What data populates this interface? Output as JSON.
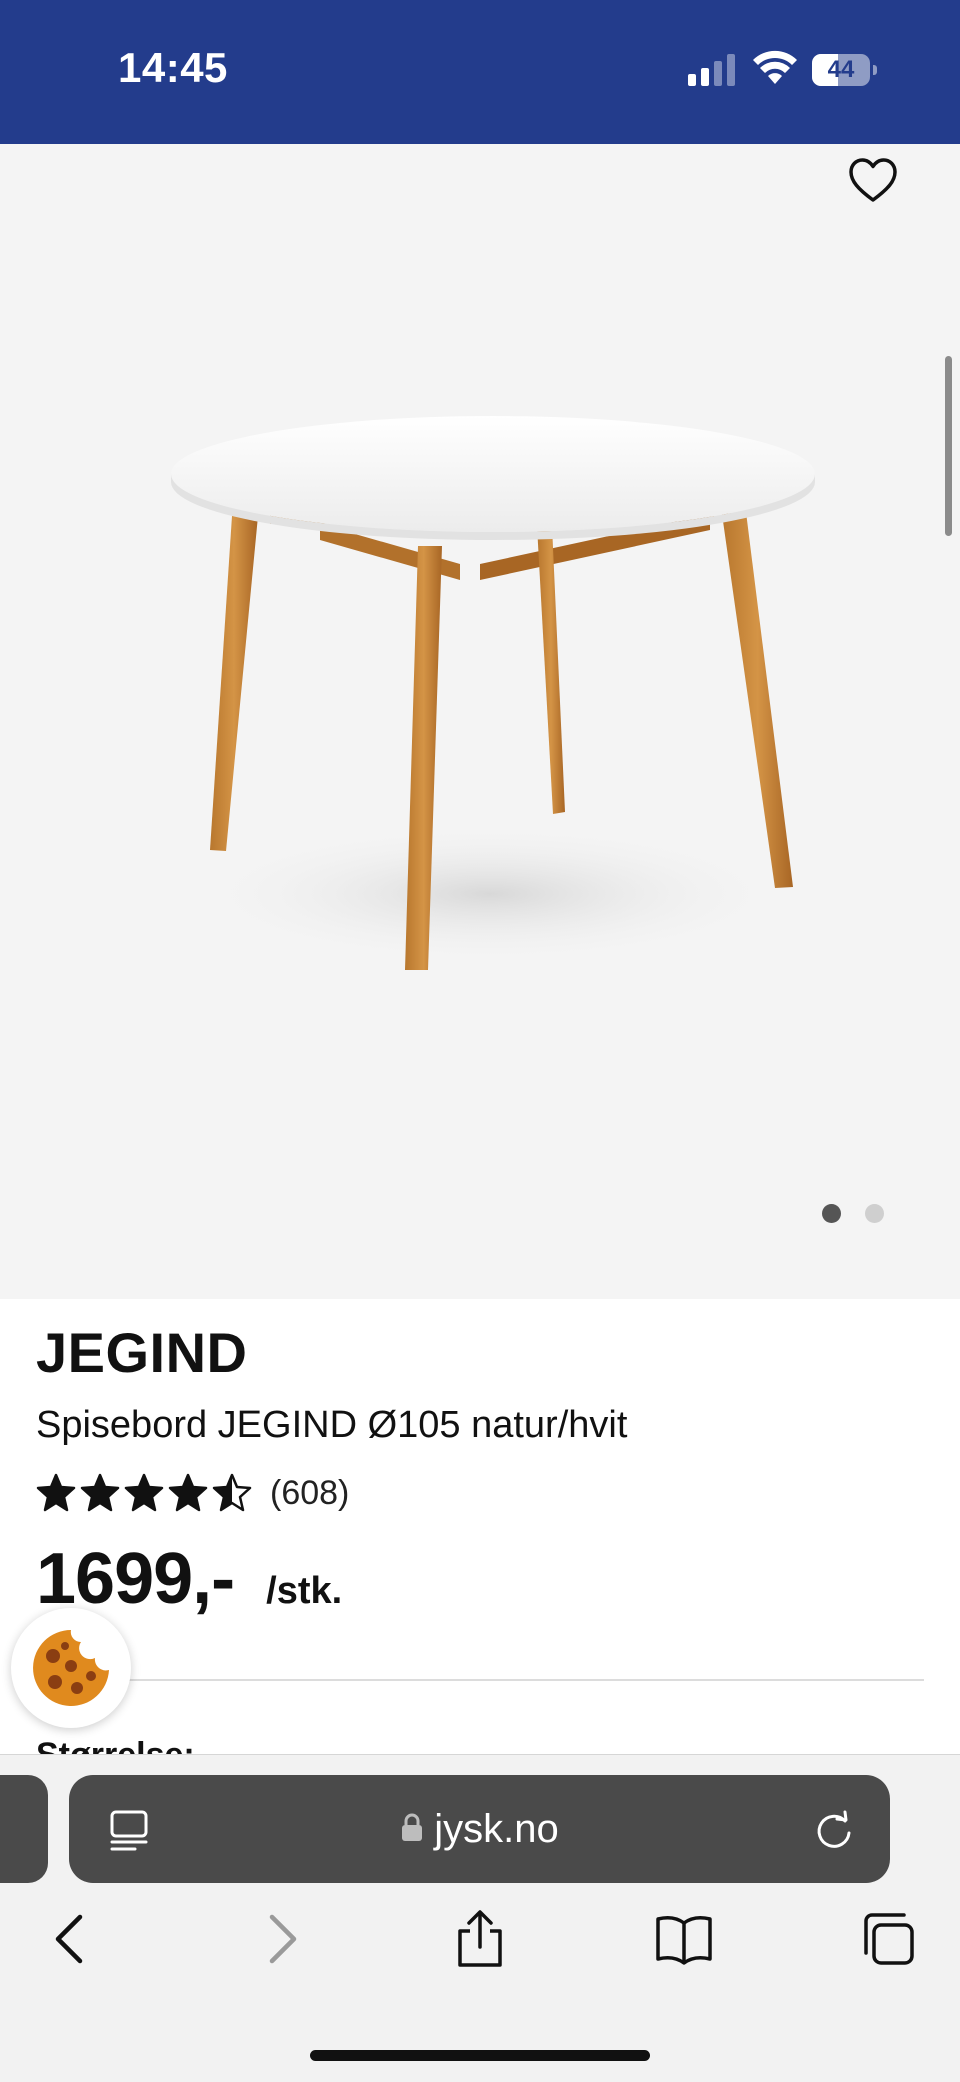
{
  "status_bar": {
    "time": "14:45",
    "battery_level": "44",
    "battery_fraction": 0.44,
    "background_color": "#233c8c"
  },
  "gallery": {
    "favorite_icon": "heart-outline-icon",
    "image": "round-dining-table-white-top-oak-legs",
    "page_count": 2,
    "active_page": 1
  },
  "product": {
    "brand": "JEGIND",
    "name": "Spisebord JEGIND Ø105 natur/hvit",
    "rating": 4.5,
    "rating_max": 5,
    "review_count": "(608)",
    "price": "1699,-",
    "unit": "/stk.",
    "size_label": "Størrelse:"
  },
  "cookie_button": {
    "icon": "cookie-icon"
  },
  "browser": {
    "url": "jysk.no",
    "reader_icon": "reader-mode-icon",
    "lock_icon": "lock-icon",
    "reload_icon": "reload-icon",
    "toolbar": [
      "back-icon",
      "forward-icon",
      "share-icon",
      "bookmarks-icon",
      "tabs-icon"
    ]
  }
}
